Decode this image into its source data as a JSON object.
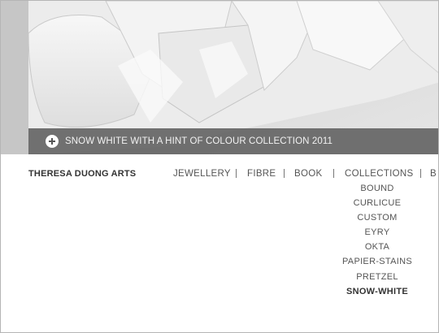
{
  "hero": {
    "caption": "SNOW WHITE WITH A HINT OF COLOUR COLLECTION 2011"
  },
  "brand": "THERESA DUONG ARTS",
  "nav": {
    "jewellery": "JEWELLERY",
    "fibre": "FIBRE",
    "book": "BOOK",
    "collections": "COLLECTIONS",
    "truncated": "B"
  },
  "submenu": {
    "items": [
      "BOUND",
      "CURLICUE",
      "CUSTOM",
      "EYRY",
      "OKTA",
      "PAPIER-STAINS",
      "PRETZEL",
      "SNOW-WHITE"
    ],
    "active": "SNOW-WHITE"
  }
}
